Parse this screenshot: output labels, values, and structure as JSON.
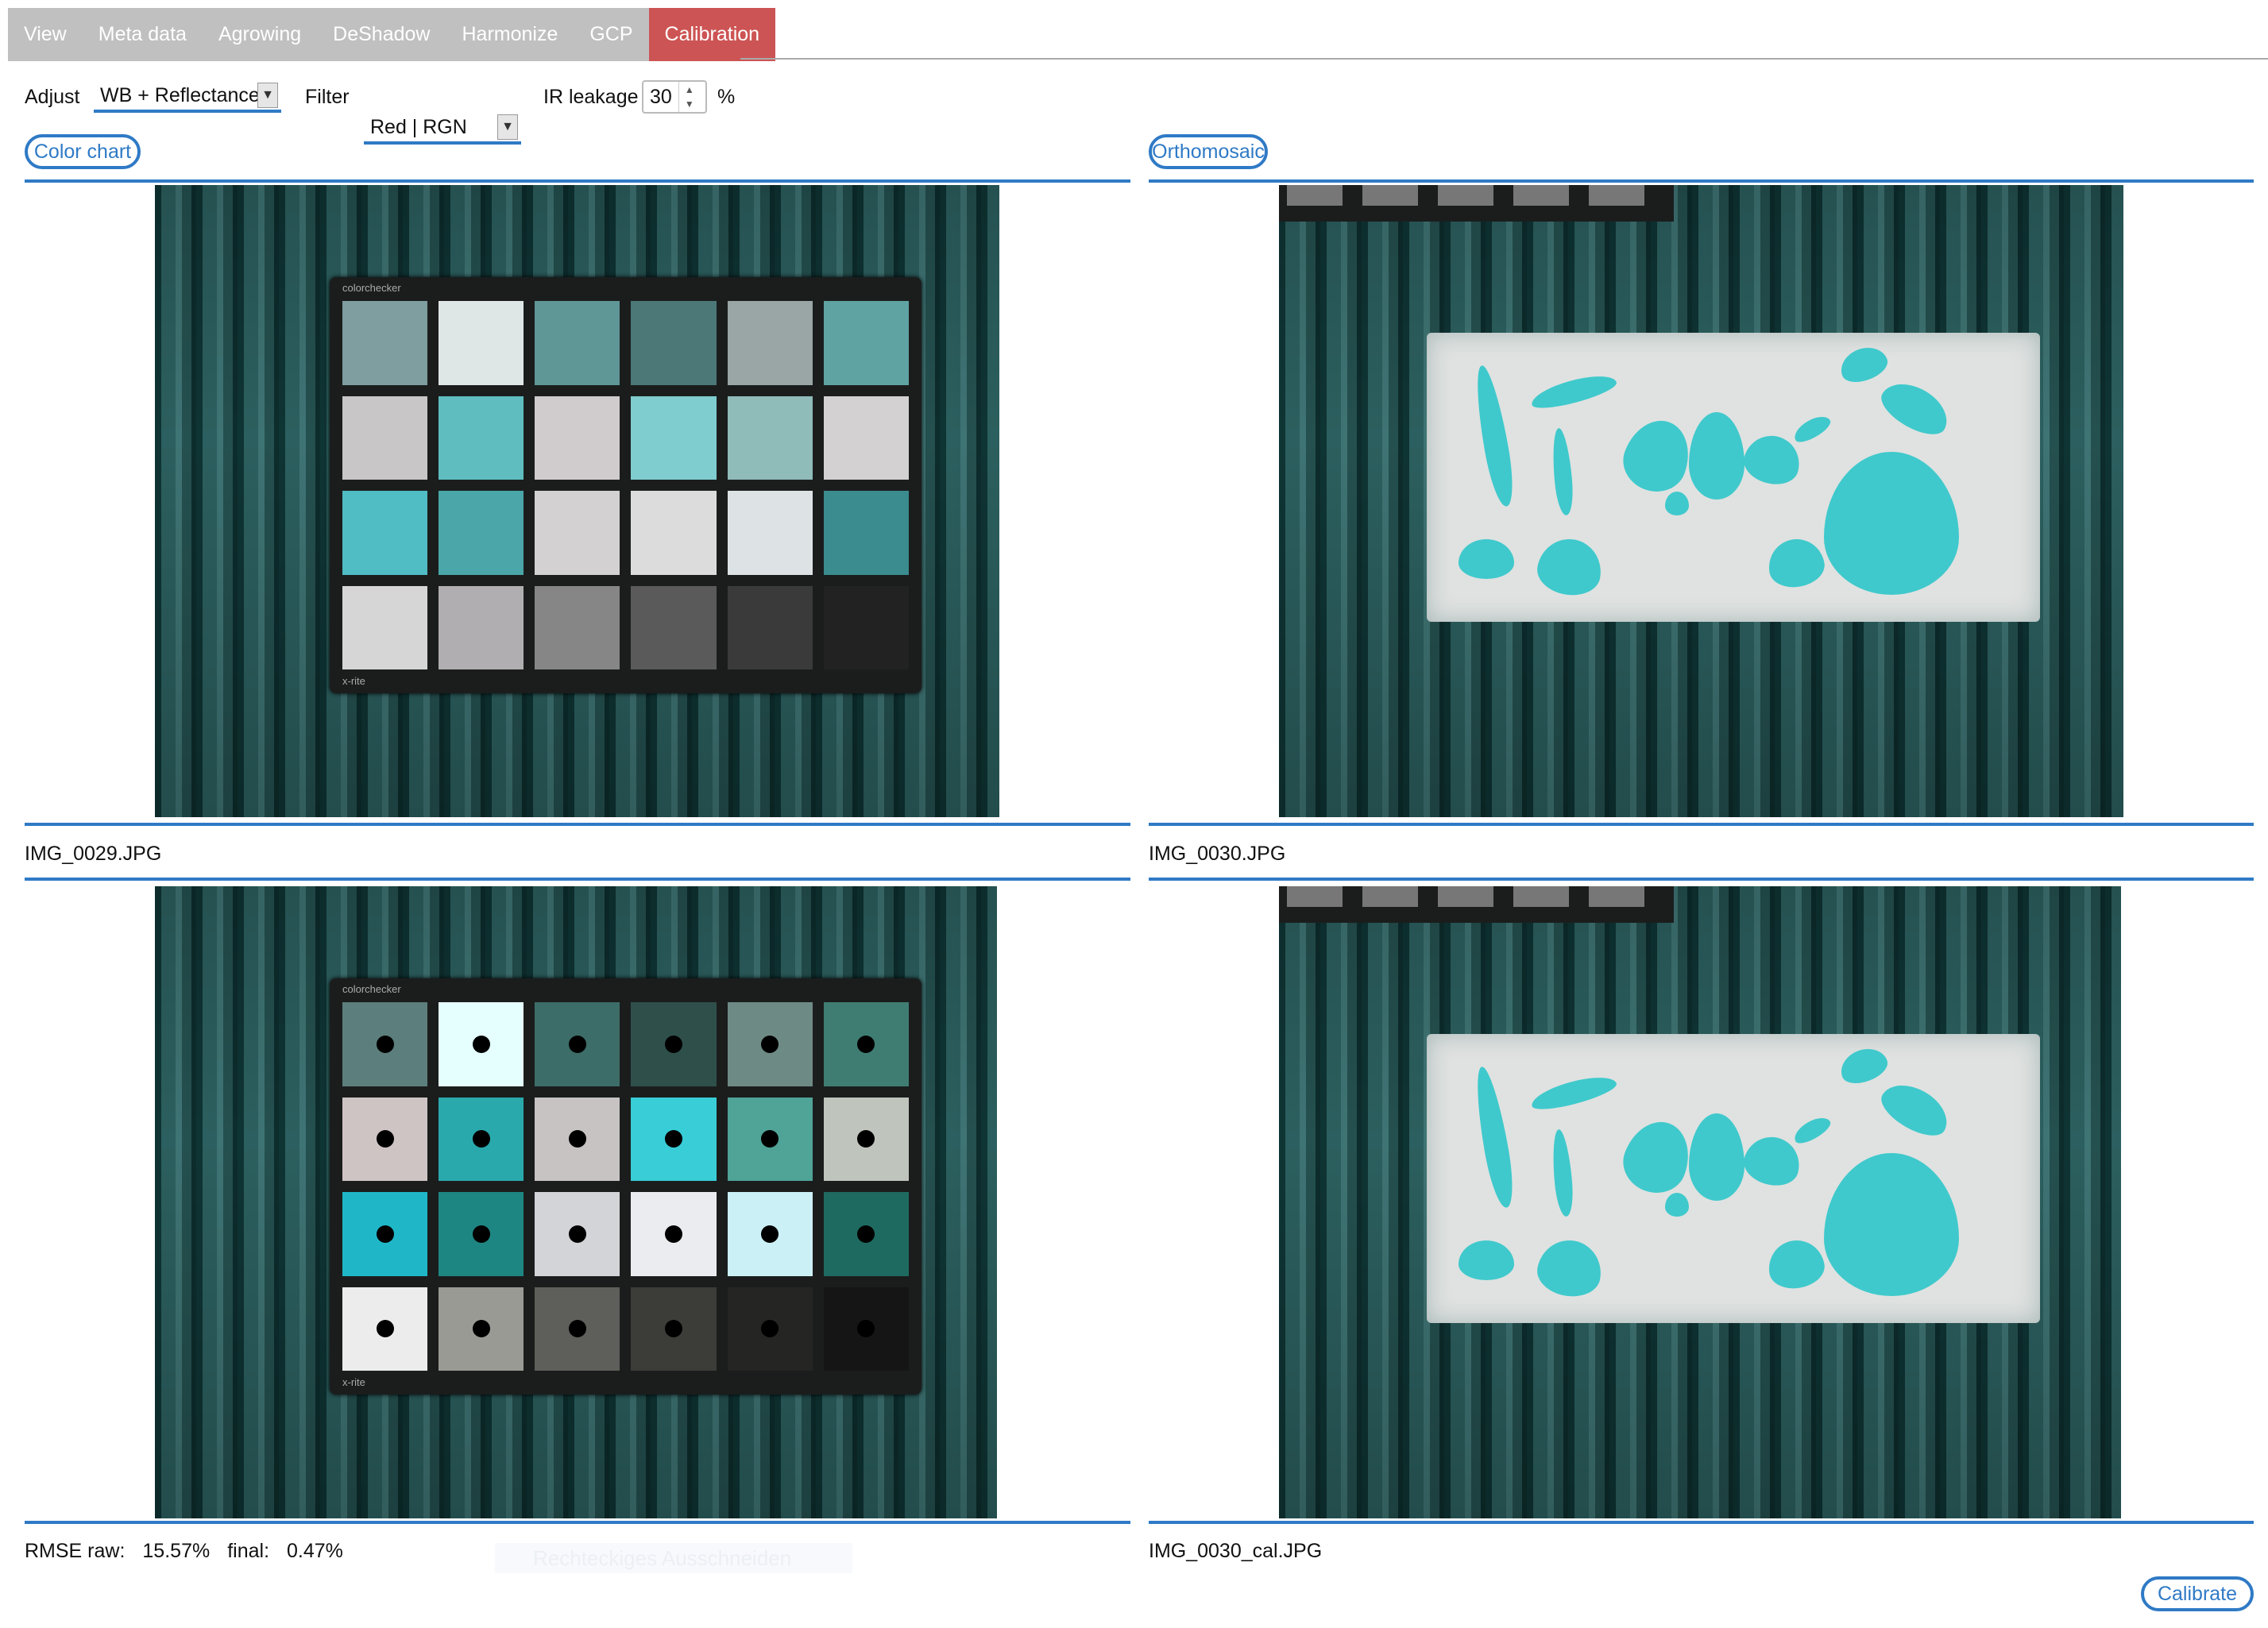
{
  "tabs": [
    {
      "label": "View"
    },
    {
      "label": "Meta data"
    },
    {
      "label": "Agrowing"
    },
    {
      "label": "DeShadow"
    },
    {
      "label": "Harmonize"
    },
    {
      "label": "GCP"
    },
    {
      "label": "Calibration",
      "active": true
    }
  ],
  "toolbar": {
    "adjust_label": "Adjust",
    "adjust_value": "WB + Reflectance",
    "filter_label": "Filter",
    "filter_value": "Red | RGN",
    "ir_label": "IR leakage",
    "ir_value": "30",
    "ir_unit": "%"
  },
  "left": {
    "section_button": "Color chart",
    "top_filename": "IMG_0029.JPG",
    "rmse_label": "RMSE raw:",
    "rmse_raw": "15.57%",
    "final_label": "final:",
    "rmse_final": "0.47%"
  },
  "right": {
    "section_button": "Orthomosaic",
    "top_filename": "IMG_0030.JPG",
    "bottom_filename": "IMG_0030_cal.JPG"
  },
  "ghost_tooltip": "Rechteckiges Ausschneiden",
  "calibrate_button": "Calibrate",
  "chart_card": {
    "brand": "colorchecker",
    "maker": "x-rite"
  },
  "colors": {
    "accent": "#2f7ac6",
    "active_tab": "#cd5454",
    "tab_bar": "#c0c0c0"
  },
  "patches_raw": [
    "#7e9ea0",
    "#dfe6e6",
    "#5f9797",
    "#4c7878",
    "#9aa6a6",
    "#5fa3a3",
    "#c9c6c8",
    "#5fbdbf",
    "#d0cccd",
    "#7fcdcf",
    "#8fbbb9",
    "#d3d1d2",
    "#50bcc4",
    "#4aa6a8",
    "#d3d1d2",
    "#dcdcdc",
    "#dde3e5",
    "#3b8c8e",
    "#d6d6d6",
    "#b0aeb0",
    "#868686",
    "#5a5a5a",
    "#3a3a3a",
    "#222222"
  ],
  "patches_cal": [
    "#5c7e7c",
    "#e5ffff",
    "#3c6d68",
    "#2f4f4b",
    "#6e8a85",
    "#3f7d73",
    "#cfc4c4",
    "#2aa9ad",
    "#c7c3c2",
    "#38cdd7",
    "#4fa397",
    "#bfc4bd",
    "#1fb7c8",
    "#1e8682",
    "#d3d4d8",
    "#eaecef",
    "#cbf0f5",
    "#1f6a60",
    "#ececec",
    "#9a9a95",
    "#5e5f5a",
    "#3c3c38",
    "#252523",
    "#151515"
  ]
}
